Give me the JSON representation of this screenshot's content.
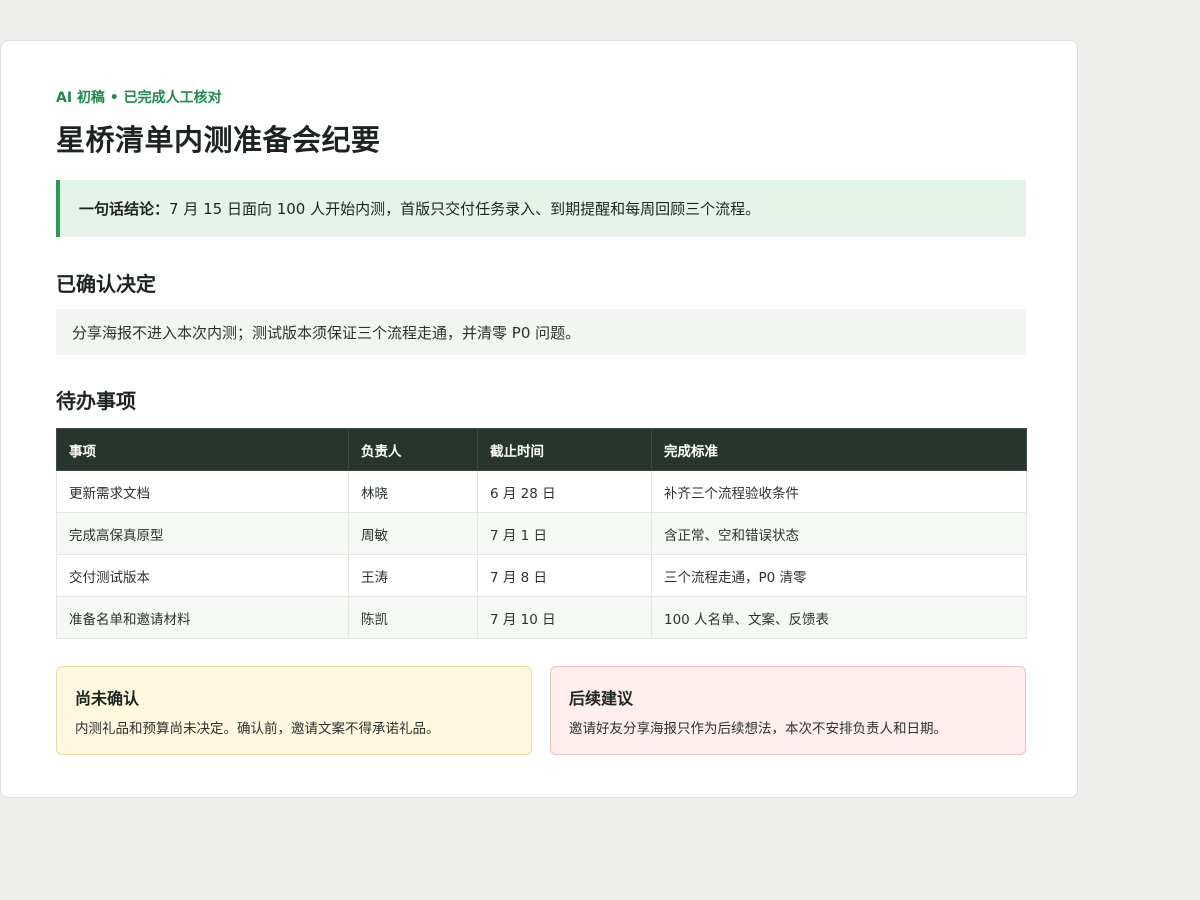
{
  "doc": {
    "eyebrow": "AI 初稿 • 已完成人工核对",
    "title": "星桥清单内测准备会纪要",
    "summary": {
      "label": "一句话结论：",
      "text": "7 月 15 日面向 100 人开始内测，首版只交付任务录入、到期提醒和每周回顾三个流程。"
    },
    "decisions": {
      "heading": "已确认决定",
      "text": "分享海报不进入本次内测；测试版本须保证三个流程走通，并清零 P0 问题。"
    },
    "todos": {
      "heading": "待办事项",
      "columns": [
        "事项",
        "负责人",
        "截止时间",
        "完成标准"
      ],
      "rows": [
        [
          "更新需求文档",
          "林晓",
          "6 月 28 日",
          "补齐三个流程验收条件"
        ],
        [
          "完成高保真原型",
          "周敏",
          "7 月 1 日",
          "含正常、空和错误状态"
        ],
        [
          "交付测试版本",
          "王涛",
          "7 月 8 日",
          "三个流程走通，P0 清零"
        ],
        [
          "准备名单和邀请材料",
          "陈凯",
          "7 月 10 日",
          "100 人名单、文案、反馈表"
        ]
      ]
    },
    "pending": {
      "title": "尚未确认",
      "text": "内测礼品和预算尚未决定。确认前，邀请文案不得承诺礼品。"
    },
    "suggestion": {
      "title": "后续建议",
      "text": "邀请好友分享海报只作为后续想法，本次不安排负责人和日期。"
    }
  },
  "colors": {
    "accent": "#1f8a4c",
    "summary_bg": "#e5f4e8",
    "table_header_bg": "#27352d",
    "pending_bg": "#fff7e0",
    "suggestion_bg": "#ffeeec"
  }
}
